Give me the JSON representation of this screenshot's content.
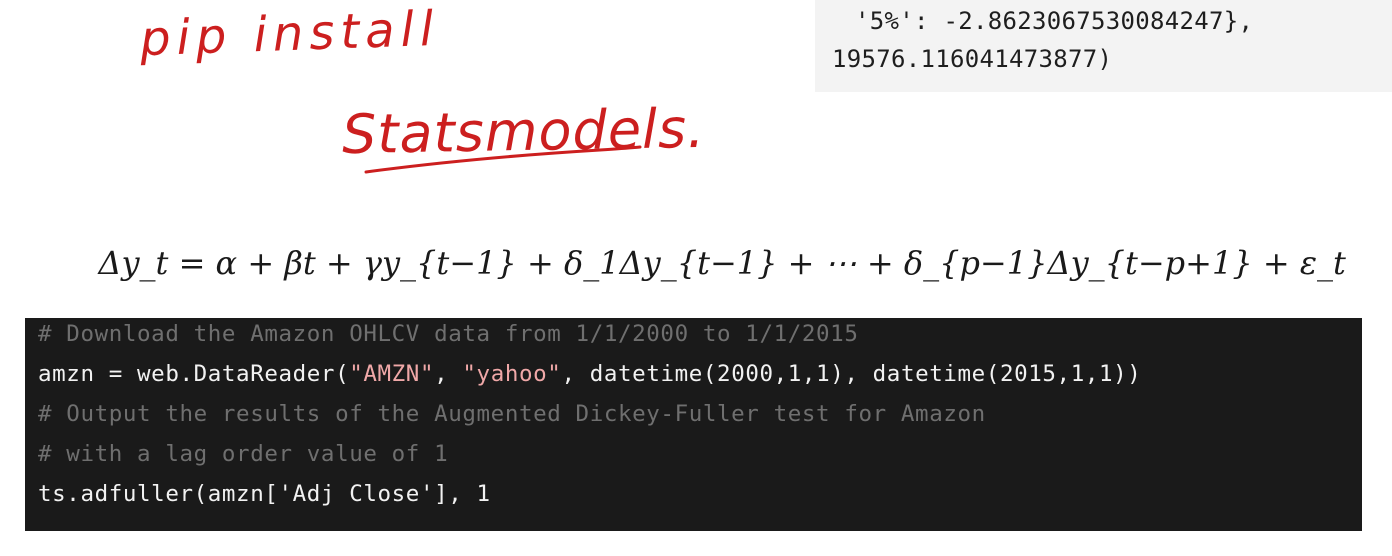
{
  "output": {
    "line1": "'5%': -2.8623067530084247},",
    "line2": "19576.116041473877)"
  },
  "annotation": {
    "line1": "pip install",
    "line2": "Statsmodels."
  },
  "equation": {
    "text": "Δy_t = α + βt + γy_{t−1} + δ_1Δy_{t−1} + ⋯ + δ_{p−1}Δy_{t−p+1} + ε_t"
  },
  "code": {
    "comment1": "# Download the Amazon OHLCV data from 1/1/2000 to 1/1/2015",
    "line2_a": "amzn = web.DataReader(",
    "line2_s1": "\"AMZN\"",
    "line2_b": ", ",
    "line2_s2": "\"yahoo\"",
    "line2_c": ", datetime(2000,1,1), datetime(2015,1,1))",
    "comment2": "# Output the results of the Augmented Dickey-Fuller test for Amazon",
    "comment3": "# with a lag order value of 1",
    "line5": "ts.adfuller(amzn['Adj Close'], 1"
  }
}
